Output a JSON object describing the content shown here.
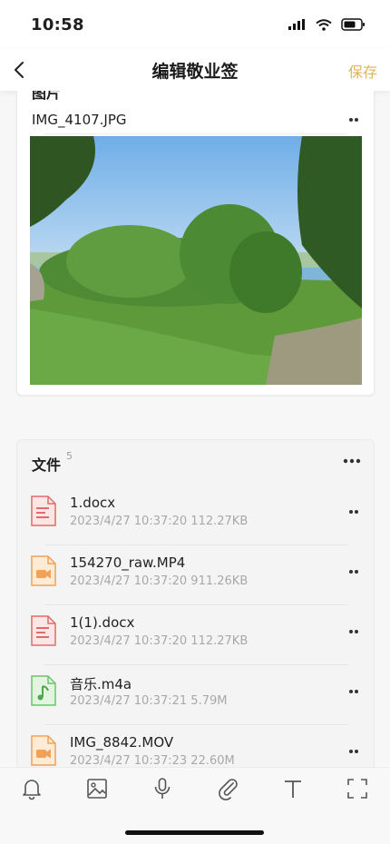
{
  "status_bar": {
    "time": "10:58"
  },
  "nav": {
    "title": "编辑敬业签",
    "save_label": "保存"
  },
  "image_section": {
    "title_cut": "图片",
    "file_name": "IMG_4107.JPG"
  },
  "files_section": {
    "title": "文件",
    "count": "5",
    "items": [
      {
        "name": "1.docx",
        "meta": "2023/4/27 10:37:20  112.27KB",
        "type": "doc"
      },
      {
        "name": "154270_raw.MP4",
        "meta": "2023/4/27 10:37:20  911.26KB",
        "type": "video"
      },
      {
        "name": "1(1).docx",
        "meta": "2023/4/27 10:37:20  112.27KB",
        "type": "doc"
      },
      {
        "name": "音乐.m4a",
        "meta": "2023/4/27 10:37:21  5.79M",
        "type": "audio"
      },
      {
        "name": "IMG_8842.MOV",
        "meta": "2023/4/27 10:37:23  22.60M",
        "type": "video"
      }
    ]
  },
  "toolbar": {
    "icons": [
      "bell-icon",
      "image-icon",
      "microphone-icon",
      "paperclip-icon",
      "text-icon",
      "fullscreen-icon"
    ]
  },
  "colors": {
    "accent": "#e2b35a",
    "doc": "#e06b6b",
    "video": "#f0a25a",
    "audio": "#6cc46b"
  }
}
